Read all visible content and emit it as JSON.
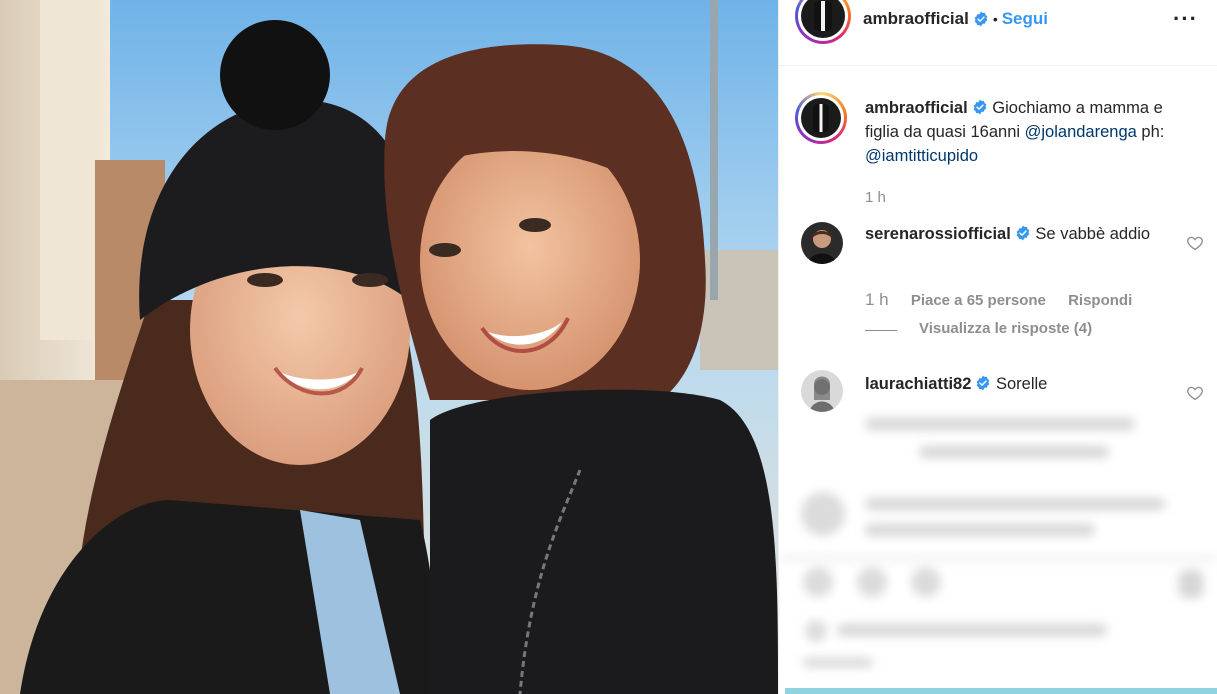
{
  "post": {
    "username": "ambraofficial",
    "follow_label": "Segui",
    "separator": "•",
    "more_label": "···"
  },
  "caption": {
    "username": "ambraofficial",
    "text": "Giochiamo a mamma e figlia da quasi 16anni",
    "mention1": "@jolandarenga",
    "text2": "ph:",
    "mention2": "@iamtitticupido",
    "time": "1 h"
  },
  "comments": [
    {
      "username": "serenarossiofficial",
      "text": "Se vabbè addio",
      "time": "1 h",
      "likes": "Piace a 65 persone",
      "reply": "Rispondi",
      "view_replies": "Visualizza le risposte (4)"
    },
    {
      "username": "laurachiatti82",
      "text": "Sorelle"
    }
  ],
  "colors": {
    "link": "#3897f0",
    "mention": "#00376b",
    "meta": "#8e8e8e",
    "verified": "#3897f0"
  },
  "icons": [
    "verified-badge-icon",
    "more-options-icon",
    "heart-icon"
  ]
}
